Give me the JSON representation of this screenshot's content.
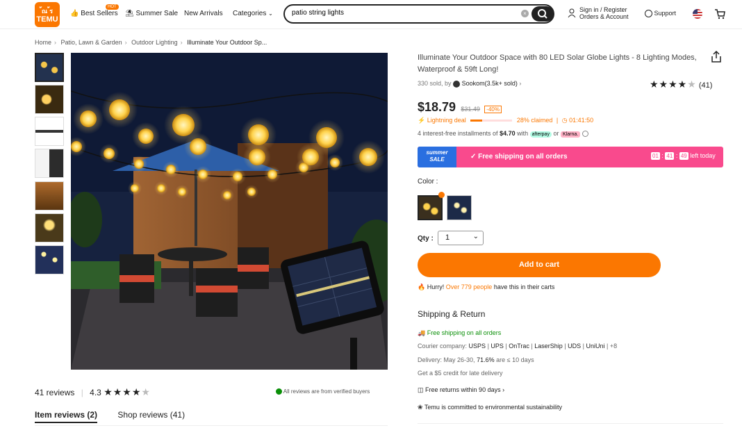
{
  "header": {
    "logo_top": "้ณ ้ร",
    "logo_bottom": "TEMU",
    "nav": [
      "Best Sellers",
      "Summer Sale",
      "New Arrivals",
      "Categories"
    ],
    "hot_badge": "HOT",
    "search_value": "patio string lights",
    "signin_line1": "Sign in / Register",
    "signin_line2": "Orders & Account",
    "support": "Support"
  },
  "breadcrumb": [
    "Home",
    "Patio, Lawn & Garden",
    "Outdoor Lighting",
    "Illuminate Your Outdoor Sp..."
  ],
  "product": {
    "title": "Illuminate Your Outdoor Space with 80 LED Solar Globe Lights - 8 Lighting Modes, Waterproof & 59ft Long!",
    "sold": "330 sold, by",
    "seller": "Sookom(3.5k+ sold)",
    "rating_count": "(41)",
    "price": "$18.79",
    "old_price": "$31.49",
    "discount": "-40%",
    "deal_label": "Lightning deal",
    "claimed": "28% claimed",
    "claimed_fraction": 0.28,
    "deal_timer": "01:41:50",
    "installments_prefix": "4 interest-free installments of",
    "installment_amount": "$4.70",
    "installments_with": "with",
    "afterpay": "afterpay",
    "or": "or",
    "klarna": "Klarna.",
    "banner_tag_line1": "summer",
    "banner_tag_line2": "SALE",
    "banner_text": "Free shipping on all orders",
    "timer_h": "01",
    "timer_m": "41",
    "timer_s": "49",
    "timer_suffix": "left today",
    "color_label": "Color :",
    "qty_label": "Qty :",
    "qty_value": "1",
    "add_to_cart": "Add to cart",
    "hurry_prefix": "Hurry!",
    "hurry_count": "Over 779 people",
    "hurry_suffix": "have this in their carts"
  },
  "shipping": {
    "heading": "Shipping & Return",
    "free": "Free shipping on all orders",
    "courier_label": "Courier company:",
    "couriers": [
      "USPS",
      "UPS",
      "OnTrac",
      "LaserShip",
      "UDS",
      "UniUni"
    ],
    "couriers_more": "+8",
    "delivery_prefix": "Delivery:",
    "delivery_dates": "May 26-30,",
    "delivery_pct": "71.6%",
    "delivery_suffix": "are ≤ 10 days",
    "credit": "Get a $5 credit for late delivery",
    "returns": "Free returns within 90 days",
    "sustain": "Temu is committed to environmental sustainability"
  },
  "reviews": {
    "count": "41 reviews",
    "score": "4.3",
    "verified": "All reviews are from verified buyers",
    "tab_item": "Item reviews (2)",
    "tab_shop": "Shop reviews (41)"
  },
  "colors": {
    "accent": "#fb7701",
    "pink": "#f94a8d",
    "green": "#0a8f08"
  }
}
